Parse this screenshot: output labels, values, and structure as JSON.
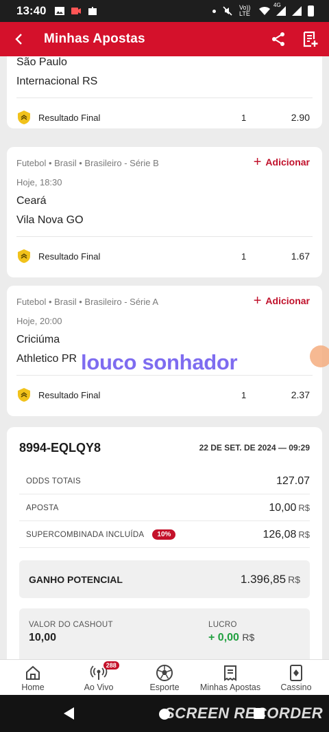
{
  "status_bar": {
    "time": "13:40",
    "network": "Vo)) LTE",
    "signal_label": "4G"
  },
  "app_bar": {
    "title": "Minhas Apostas"
  },
  "bets": [
    {
      "teams": [
        "São Paulo",
        "Internacional RS"
      ],
      "market": "Resultado Final",
      "selection": "1",
      "odds": "2.90"
    },
    {
      "league": "Futebol • Brasil • Brasileiro - Série B",
      "add_label": "Adicionar",
      "time": "Hoje, 18:30",
      "teams": [
        "Ceará",
        "Vila Nova GO"
      ],
      "market": "Resultado Final",
      "selection": "1",
      "odds": "1.67"
    },
    {
      "league": "Futebol • Brasil • Brasileiro - Série A",
      "add_label": "Adicionar",
      "time": "Hoje, 20:00",
      "teams": [
        "Criciúma",
        "Athletico PR"
      ],
      "market": "Resultado Final",
      "selection": "1",
      "odds": "2.37"
    }
  ],
  "summary": {
    "ticket_id": "8994-EQLQY8",
    "date": "22 DE SET. DE 2024 — 09:29",
    "odds_total_label": "ODDS TOTAIS",
    "odds_total": "127.07",
    "stake_label": "APOSTA",
    "stake": "10,00",
    "supercombo_label": "SUPERCOMBINADA INCLUÍDA",
    "supercombo_badge": "10%",
    "supercombo_value": "126,08",
    "currency": "R$",
    "potential_label": "GANHO POTENCIAL",
    "potential_value": "1.396,85",
    "cashout_label": "VALOR DO CASHOUT",
    "cashout_value": "10,00",
    "profit_label": "LUCRO",
    "profit_value": "+ 0,00"
  },
  "overlay_text": "louco sonhador",
  "bottom_nav": {
    "items": [
      {
        "label": "Home",
        "icon": "home-icon"
      },
      {
        "label": "Ao Vivo",
        "icon": "live-icon",
        "badge": "288"
      },
      {
        "label": "Esporte",
        "icon": "soccer-ball-icon"
      },
      {
        "label": "Minhas Apostas",
        "icon": "bet-slip-icon"
      },
      {
        "label": "Cassino",
        "icon": "casino-card-icon"
      }
    ]
  },
  "watermark": "SCREEN RECORDER",
  "colors": {
    "brand_red": "#d4112b",
    "profit_green": "#21a040",
    "overlay_purple": "#7e6cf0"
  }
}
